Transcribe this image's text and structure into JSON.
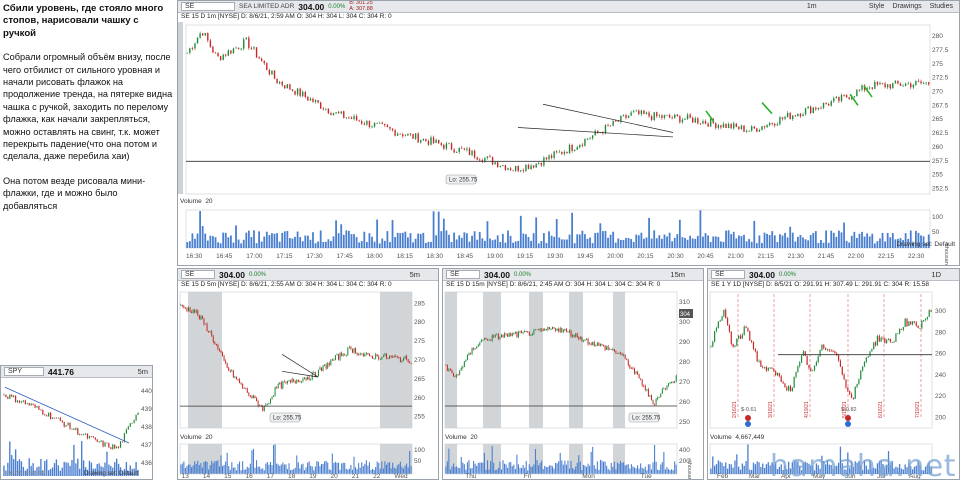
{
  "notes": {
    "header": "Сбили уровень, где стояло много стопов, нарисовали чашку с ручкой",
    "paragraph1": "Собрали огромный объём внизу, после чего отбилист от сильного уровная и начали рисовать флажок на продолжение тренда, на пятерке видна чашка с ручкой, заходить по перелому флажка, как начали закрепляться, можно оставлять на свинг, т.к. может перекрыть падение(что она потом и сделала, даже перебила хаи)",
    "paragraph2": "Она потом везде рисовала мини-флажки, где и можно было добавляться"
  },
  "main_chart": {
    "symbol": "SE",
    "description": "SEA LIMITED ADR",
    "price": "304.00",
    "change": "0.00%",
    "bid": "B: 301.25",
    "ask": "A: 307.88",
    "interval": "1m",
    "toolbar": [
      "Style",
      "Drawings",
      "Studies"
    ],
    "status": "SE 15 D 1m [NYSE]   D: 8/6/21, 2:59 AM   O: 304   H: 304   L: 304   C: 304   R: 0",
    "low_label": "Lo: 255.75",
    "volume_label": "Volume",
    "volume_len": "20",
    "drawing_set": "Drawing set: Default",
    "y_ticks": [
      "280",
      "277.5",
      "275",
      "272.5",
      "270",
      "267.5",
      "265",
      "262.5",
      "260",
      "257.5",
      "255",
      "252.5"
    ],
    "x_ticks": [
      "16:30",
      "16:45",
      "17:00",
      "17:15",
      "17:30",
      "17:45",
      "18:00",
      "18:15",
      "18:30",
      "18:45",
      "19:00",
      "19:15",
      "19:30",
      "19:45",
      "20:00",
      "20:15",
      "20:30",
      "20:45",
      "21:00",
      "21:15",
      "21:30",
      "21:45",
      "22:00",
      "22:15",
      "22:30"
    ],
    "vol_ticks": [
      "100",
      "50"
    ],
    "vol_unit": "<thousands"
  },
  "spy_chart": {
    "symbol": "SPY",
    "price": "441.76",
    "interval": "5m",
    "y_ticks": [
      "440",
      "439",
      "438",
      "437",
      "436"
    ],
    "drawing_set": "Drawing set: Default",
    "wm_date": "8/5/21, 8:55 PM"
  },
  "chart2": {
    "symbol": "SE",
    "price": "304.00",
    "change": "0.00%",
    "interval": "5m",
    "status": "SE 15 D 5m [NYSE]  D: 8/6/21, 2:55 AM  O: 304  H: 304  L: 304  C: 304  R: 0",
    "low_label": "Lo: 255.75",
    "volume_label": "Volume",
    "volume_len": "20",
    "y_ticks": [
      "285",
      "280",
      "275",
      "270",
      "265",
      "260",
      "255"
    ],
    "x_ticks": [
      "13",
      "14",
      "15",
      "16",
      "17",
      "18",
      "19",
      "20",
      "21",
      "22",
      "Wed"
    ],
    "vol_ticks": [
      "100",
      "50"
    ]
  },
  "chart3": {
    "symbol": "SE",
    "price": "304.00",
    "change": "0.00%",
    "interval": "15m",
    "status": "SE 15 D 15m [NYSE]  D: 8/6/21, 2:45 AM  O: 304  H: 304  L: 304  C: 304  R: 0",
    "low_label": "Lo: 255.75",
    "volume_label": "Volume",
    "volume_len": "20",
    "y_ticks": [
      "310",
      "304",
      "300",
      "290",
      "280",
      "270",
      "260",
      "250"
    ],
    "x_ticks": [
      "Thu",
      "Fri",
      "Mon",
      "Tue"
    ],
    "vol_ticks": [
      "400",
      "200"
    ],
    "vol_unit": "<thousands"
  },
  "chart4": {
    "symbol": "SE",
    "price": "304.00",
    "change": "0.00%",
    "interval": "1D",
    "status": "SE 1 Y 1D [NYSE]  D: 8/5/21  O: 291.91  H: 307.49  L: 291.91  C: 304  R: 15.58",
    "volume_label": "Volume",
    "volume_value": "4,667,449",
    "y_ticks": [
      "300",
      "280",
      "260",
      "240",
      "220",
      "200"
    ],
    "x_ticks": [
      "Feb",
      "Mar",
      "Apr",
      "May",
      "Jun",
      "Jul",
      "Aug"
    ],
    "earnings": [
      "$-0.61",
      "$-0.82"
    ],
    "event_dates": [
      "2/16/21",
      "3/18/21",
      "4/19/21",
      "5/18/21",
      "6/16/21",
      "7/19/21"
    ]
  },
  "watermark": "hamaha.net"
}
